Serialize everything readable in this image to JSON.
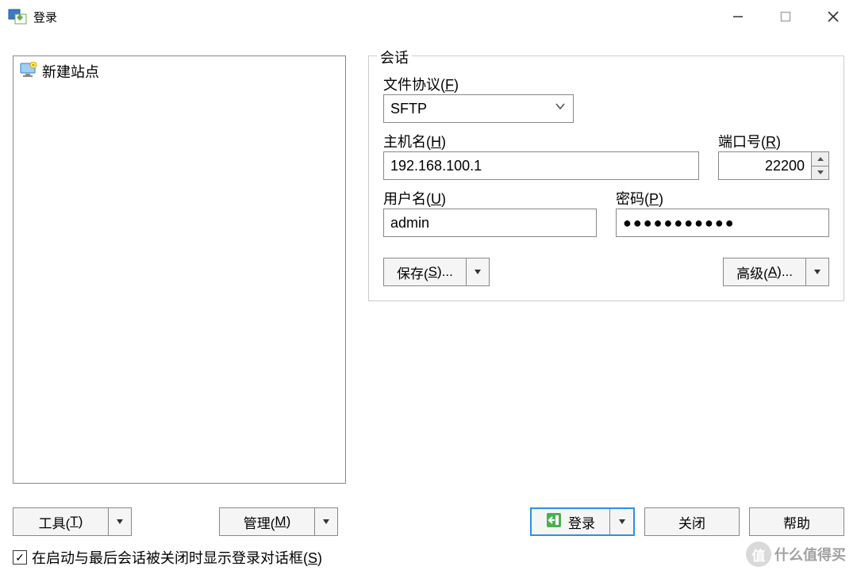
{
  "window": {
    "title": "登录"
  },
  "sites": {
    "items": [
      {
        "label": "新建站点"
      }
    ]
  },
  "session": {
    "legend": "会话",
    "protocol_label_pre": "文件协议(",
    "protocol_label_key": "F",
    "protocol_label_post": ")",
    "protocol_value": "SFTP",
    "host_label_pre": "主机名(",
    "host_label_key": "H",
    "host_label_post": ")",
    "host_value": "192.168.100.1",
    "port_label_pre": "端口号(",
    "port_label_key": "R",
    "port_label_post": ")",
    "port_value": "22200",
    "user_label_pre": "用户名(",
    "user_label_key": "U",
    "user_label_post": ")",
    "user_value": "admin",
    "pass_label_pre": "密码(",
    "pass_label_key": "P",
    "pass_label_post": ")",
    "pass_value": "●●●●●●●●●●●",
    "save_btn_pre": "保存(",
    "save_btn_key": "S",
    "save_btn_post": ")...",
    "adv_btn_pre": "高级(",
    "adv_btn_key": "A",
    "adv_btn_post": ")..."
  },
  "bottom": {
    "tools_pre": "工具(",
    "tools_key": "T",
    "tools_post": ")",
    "manage_pre": "管理(",
    "manage_key": "M",
    "manage_post": ")",
    "login": "登录",
    "close": "关闭",
    "help": "帮助"
  },
  "checkbox": {
    "label_pre": "在启动与最后会话被关闭时显示登录对话框(",
    "label_key": "S",
    "label_post": ")",
    "checked": "✓"
  },
  "watermark": {
    "badge": "值",
    "text": "什么值得买"
  }
}
